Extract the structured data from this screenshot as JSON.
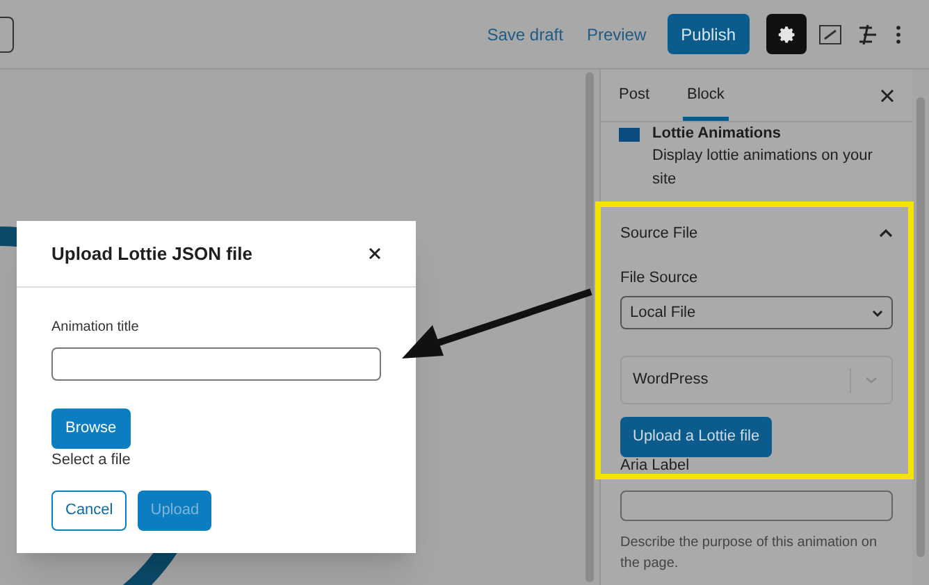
{
  "header": {
    "save_draft": "Save draft",
    "preview": "Preview",
    "publish": "Publish",
    "settings_active": true
  },
  "sidebar": {
    "tabs": [
      {
        "label": "Post",
        "selected": false
      },
      {
        "label": "Block",
        "selected": true
      }
    ],
    "block_card": {
      "title": "Lottie Animations",
      "description": "Display lottie animations on your site"
    },
    "panel": {
      "title": "Source File",
      "expanded": true,
      "highlighted": true,
      "file_source_label": "File Source",
      "file_source_value": "Local File",
      "provider_value": "WordPress",
      "upload_button": "Upload a Lottie file"
    },
    "aria_label": "Aria Label",
    "aria_help": "Describe the purpose of this animation on the page."
  },
  "modal": {
    "title": "Upload Lottie JSON file",
    "field_label": "Animation title",
    "browse": "Browse",
    "file_status": "Select a file",
    "cancel": "Cancel",
    "upload": {
      "label": "Upload",
      "disabled": true
    }
  }
}
